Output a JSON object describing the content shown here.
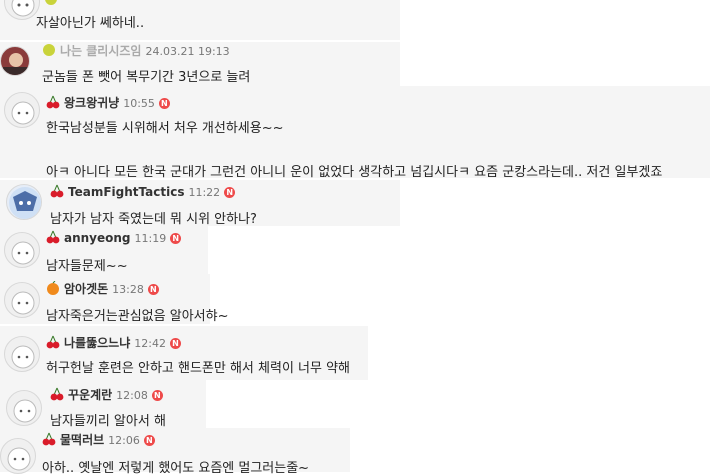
{
  "comments": [
    {
      "nick": "",
      "time": "",
      "lines": [
        "자살아닌가 쎄하네.."
      ],
      "level": "badge",
      "new": false
    },
    {
      "nick": "나는 클리시즈임",
      "time": "24.03.21 19:13",
      "lines": [
        "군놈들 폰 뺏어 복무기간 3년으로 늘려"
      ],
      "level": "badge",
      "new": false
    },
    {
      "nick": "왕크왕귀냥",
      "time": "10:55",
      "lines": [
        "한국남성분들 시위해서 처우 개선하세용~~",
        "",
        "아ㅋ 아니다 모든 한국 군대가 그런건 아니니 운이 없었다 생각하고 넘깁시다ㅋ 요즘 군캉스라는데.. 저건 일부겠죠"
      ],
      "level": "cherry",
      "new": true
    },
    {
      "nick": "TeamFightTactics",
      "time": "11:22",
      "lines": [
        "남자가 남자 죽였는데 뭐 시위 안하나?"
      ],
      "level": "cherry",
      "new": true
    },
    {
      "nick": "annyeong",
      "time": "11:19",
      "lines": [
        "남자들문제~~"
      ],
      "level": "cherry",
      "new": true
    },
    {
      "nick": "암아겟돈",
      "time": "13:28",
      "lines": [
        "남자죽은거는관심없음 알아서햐~"
      ],
      "level": "orange",
      "new": true
    },
    {
      "nick": "나를뚫으느냐",
      "time": "12:42",
      "lines": [
        "허구헌날 훈련은 안하고 핸드폰만 해서 체력이 너무 약해"
      ],
      "level": "cherry",
      "new": true
    },
    {
      "nick": "꾸운계란",
      "time": "12:08",
      "lines": [
        "남자들끼리 알아서 해"
      ],
      "level": "cherry",
      "new": true
    },
    {
      "nick": "물떡러브",
      "time": "12:06",
      "lines": [
        "아하.. 옛날엔 저렇게 했어도 요즘엔 멀그러는줄~"
      ],
      "level": "cherry",
      "new": true
    }
  ],
  "new_badge_label": "N",
  "colors": {
    "cherry": "#d91c2a",
    "orange": "#f08a1c",
    "badge": "#c9d33a",
    "new": "#ee4a4a"
  }
}
